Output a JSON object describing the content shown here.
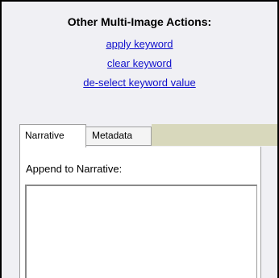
{
  "actions": {
    "title": "Other Multi-Image Actions:",
    "links": {
      "apply_keyword": "apply keyword",
      "clear_keyword": "clear keyword",
      "deselect_keyword_value": "de-select keyword value"
    }
  },
  "tabs": {
    "narrative": "Narrative",
    "metadata": "Metadata",
    "active": "Narrative"
  },
  "narrative_panel": {
    "append_label": "Append to Narrative:",
    "append_value": ""
  },
  "colors": {
    "link": "#1010cc",
    "panel_background": "#f0f0f4",
    "tab_strip_fill": "#d8d8bc"
  }
}
